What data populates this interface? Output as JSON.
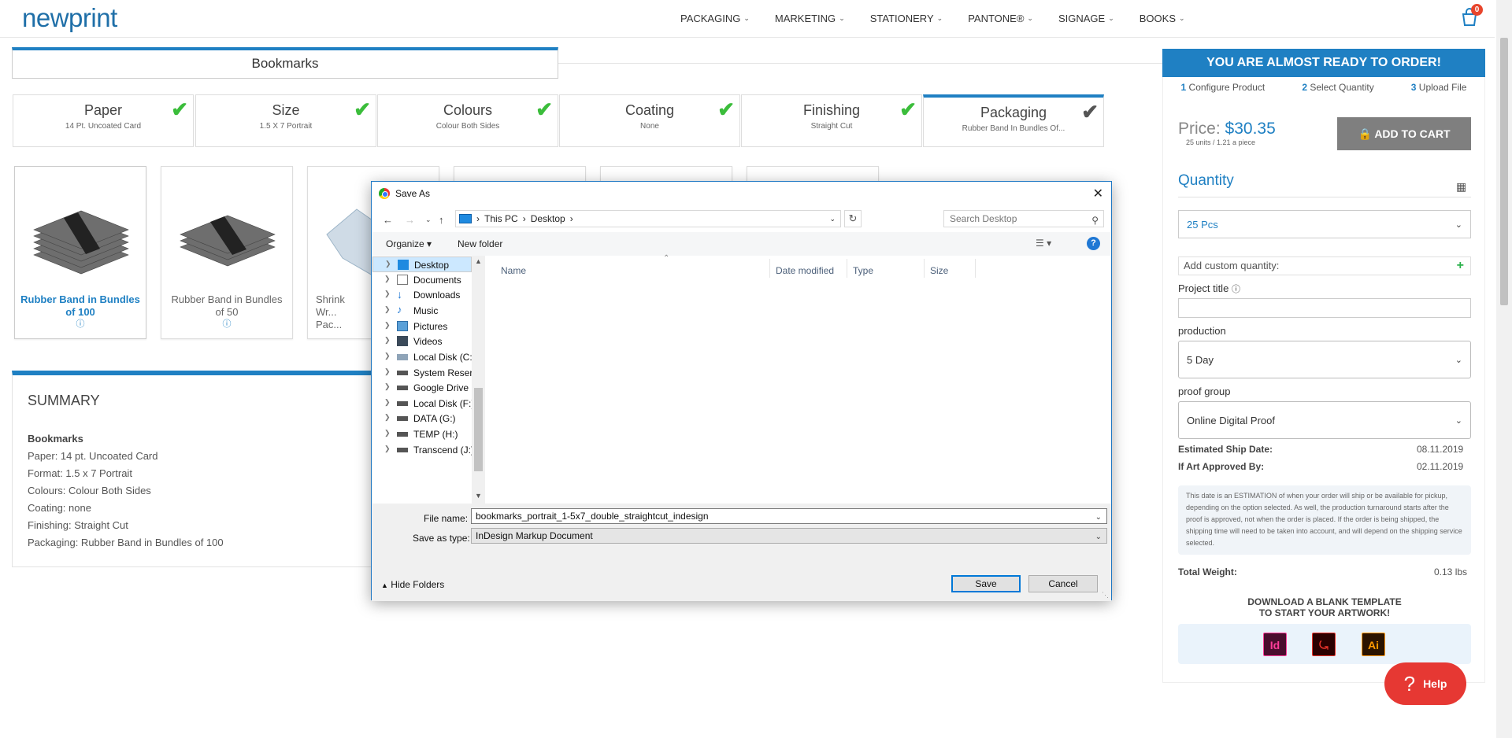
{
  "header": {
    "logo": "newprint",
    "nav": [
      "PACKAGING",
      "MARKETING",
      "STATIONERY",
      "PANTONE®",
      "SIGNAGE",
      "BOOKS"
    ],
    "cart_count": "0"
  },
  "product": {
    "title": "Bookmarks",
    "steps": [
      {
        "title": "Paper",
        "value": "14 Pt. Uncoated Card"
      },
      {
        "title": "Size",
        "value": "1.5 X 7 Portrait"
      },
      {
        "title": "Colours",
        "value": "Colour Both Sides"
      },
      {
        "title": "Coating",
        "value": "None"
      },
      {
        "title": "Finishing",
        "value": "Straight Cut"
      },
      {
        "title": "Packaging",
        "value": "Rubber Band In Bundles Of..."
      }
    ],
    "options": [
      {
        "label": "Rubber Band in Bundles of 100"
      },
      {
        "label": "Rubber Band in Bundles of 50"
      },
      {
        "label": "Shrink Wr... Pac..."
      }
    ]
  },
  "summary": {
    "heading": "SUMMARY",
    "product": "Bookmarks",
    "lines": [
      "Paper: 14 pt. Uncoated Card",
      "Format: 1.5 x 7 Portrait",
      "Colours: Colour Both Sides",
      "Coating: none",
      "Finishing: Straight Cut",
      "Packaging: Rubber Band in Bundles of 100"
    ]
  },
  "order": {
    "banner": "YOU ARE ALMOST READY TO ORDER!",
    "steps": [
      {
        "num": "1",
        "label": "Configure Product"
      },
      {
        "num": "2",
        "label": "Select Quantity"
      },
      {
        "num": "3",
        "label": "Upload File"
      }
    ],
    "price_label": "Price:",
    "price": "$30.35",
    "units": "25 units / 1.21 a piece",
    "add_to_cart": "ADD TO CART",
    "quantity_title": "Quantity",
    "quantity_value": "25 Pcs",
    "custom_qty_placeholder": "Add custom quantity:",
    "project_title_label": "Project title",
    "production_label": "production",
    "production_value": "5 Day",
    "proof_label": "proof group",
    "proof_value": "Online Digital Proof",
    "ship_date_label": "Estimated Ship Date:",
    "ship_date": "08.11.2019",
    "approved_label": "If Art Approved By:",
    "approved_date": "02.11.2019",
    "note": "This date is an ESTIMATION of when your order will ship or be available for pickup, depending on the option selected. As well, the production turnaround starts after the proof is approved, not when the order is placed. If the order is being shipped, the shipping time will need to be taken into account, and will depend on the shipping service selected.",
    "weight_label": "Total Weight:",
    "weight": "0.13 lbs",
    "download_title_1": "DOWNLOAD A BLANK TEMPLATE",
    "download_title_2": "TO START YOUR ARTWORK!",
    "templates": [
      "Id",
      "Ai"
    ],
    "help": "Help"
  },
  "dialog": {
    "title": "Save As",
    "path": [
      "This PC",
      "Desktop"
    ],
    "search_placeholder": "Search Desktop",
    "organize": "Organize",
    "new_folder": "New folder",
    "tree": [
      "Desktop",
      "Documents",
      "Downloads",
      "Music",
      "Pictures",
      "Videos",
      "Local Disk (C:)",
      "System Reserved",
      "Google Drive File",
      "Local Disk (F:)",
      "DATA (G:)",
      "TEMP (H:)",
      "Transcend (J:)"
    ],
    "columns": [
      "Name",
      "Date modified",
      "Type",
      "Size"
    ],
    "file_name_label": "File name:",
    "file_name": "bookmarks_portrait_1-5x7_double_straightcut_indesign",
    "save_type_label": "Save as type:",
    "save_type": "InDesign Markup Document",
    "hide_folders": "Hide Folders",
    "save": "Save",
    "cancel": "Cancel"
  }
}
